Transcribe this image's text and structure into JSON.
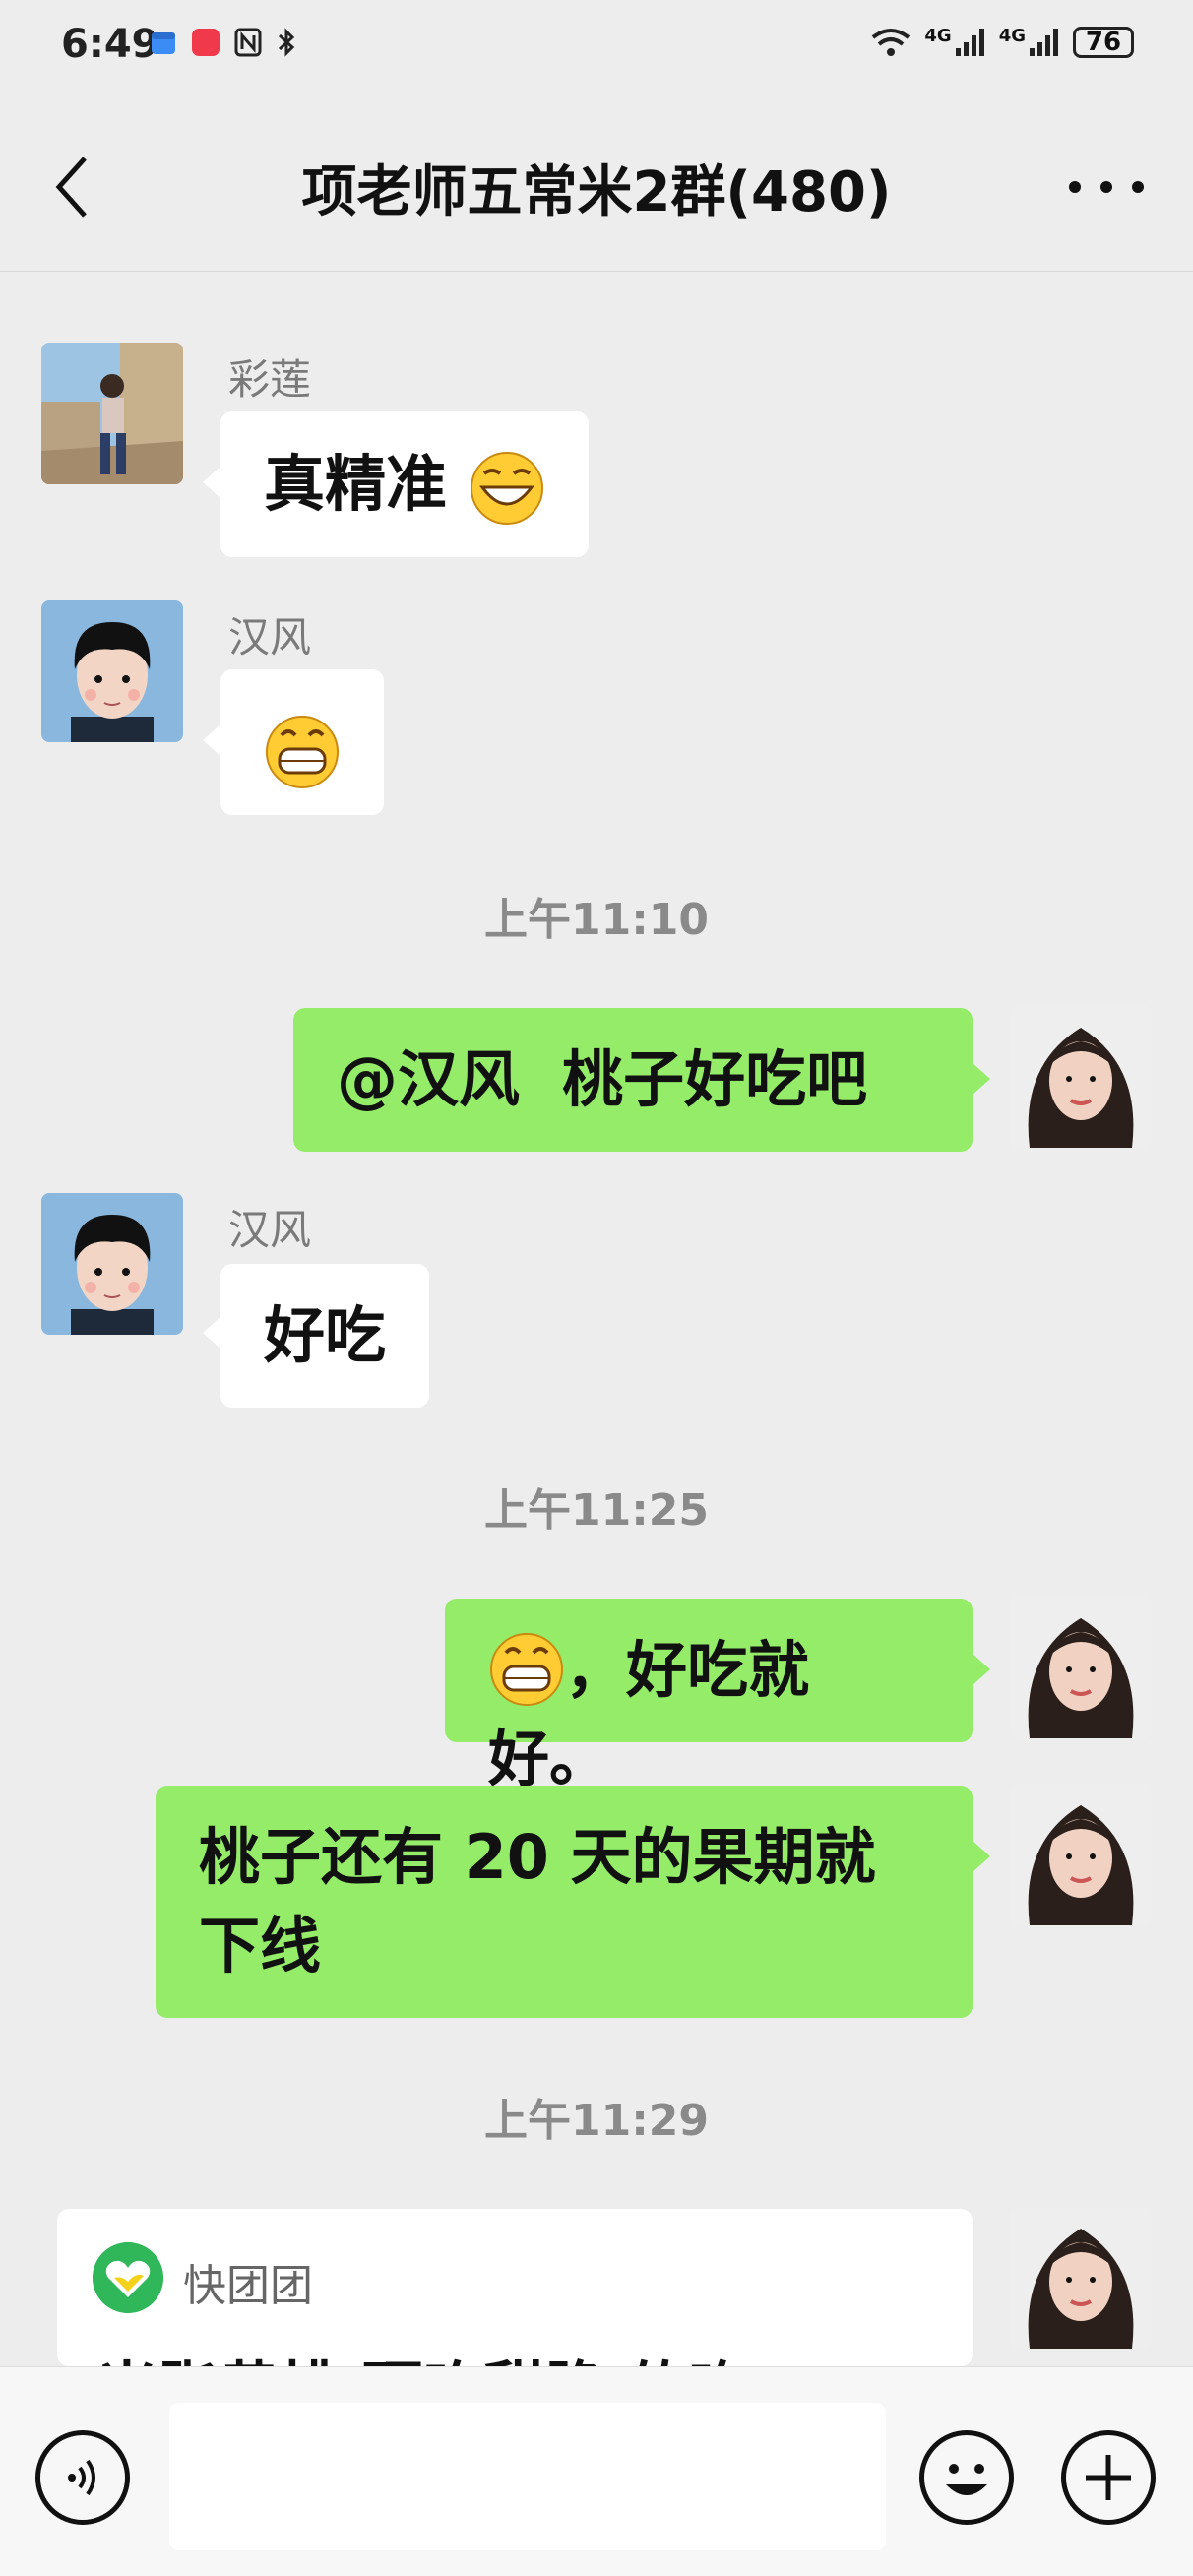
{
  "status_bar": {
    "time": "6:49",
    "network_a": "4G",
    "network_b": "4G",
    "battery": "76"
  },
  "header": {
    "title": "项老师五常米2群(480)"
  },
  "messages": [
    {
      "type": "incoming",
      "sender": "彩莲",
      "text": "真精准"
    },
    {
      "type": "incoming",
      "sender": "汉风",
      "text": ""
    },
    {
      "type": "timestamp",
      "text": "上午11:10"
    },
    {
      "type": "outgoing",
      "text": "@汉风  桃子好吃吧"
    },
    {
      "type": "incoming",
      "sender": "汉风",
      "text": "好吃"
    },
    {
      "type": "timestamp",
      "text": "上午11:25"
    },
    {
      "type": "outgoing",
      "text": "，好吃就好。"
    },
    {
      "type": "outgoing",
      "line1": "桃子还有 20 天的果期就",
      "line2": "下线"
    },
    {
      "type": "timestamp",
      "text": "上午11:29"
    }
  ],
  "card": {
    "app": "快团团",
    "preview": "米脂黄桃 硬吃甜脆 软吃"
  },
  "icons": {
    "back": "back-chevron-icon",
    "more": "more-dots-icon",
    "voice": "voice-icon",
    "emoji": "emoji-icon",
    "plus": "plus-icon"
  },
  "colors": {
    "outgoing_bubble": "#95ec69",
    "incoming_bubble": "#ffffff",
    "background": "#ededed"
  }
}
